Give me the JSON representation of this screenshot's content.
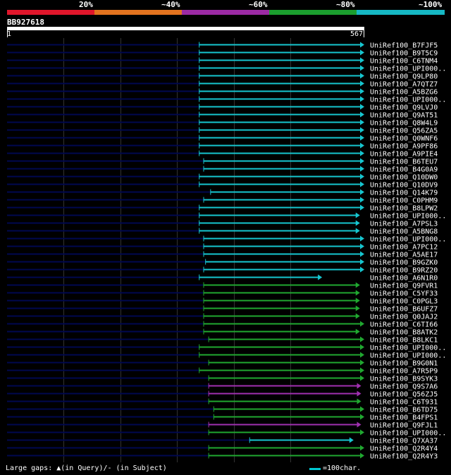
{
  "legend": {
    "labels": [
      "20%",
      "~40%",
      "~60%",
      "~80%",
      "~100%"
    ],
    "colors": [
      "#e0162b",
      "#e2731f",
      "#9b2aa3",
      "#1b9e2e",
      "#16b8c4"
    ]
  },
  "query": {
    "name": "BB927618",
    "start": "1",
    "end": "567",
    "length": 567
  },
  "hits": [
    {
      "name": "UniRef100_B7FJF5",
      "start": 305,
      "end": 567,
      "color": "cyan"
    },
    {
      "name": "UniRef100_B9T5C9",
      "start": 305,
      "end": 567,
      "color": "cyan"
    },
    {
      "name": "UniRef100_C6TNM4",
      "start": 305,
      "end": 567,
      "color": "cyan"
    },
    {
      "name": "UniRef100_UPI000..",
      "start": 305,
      "end": 567,
      "color": "cyan"
    },
    {
      "name": "UniRef100_Q9LP80",
      "start": 305,
      "end": 567,
      "color": "cyan"
    },
    {
      "name": "UniRef100_A7QTZ7",
      "start": 305,
      "end": 567,
      "color": "cyan"
    },
    {
      "name": "UniRef100_A5BZG6",
      "start": 305,
      "end": 567,
      "color": "cyan"
    },
    {
      "name": "UniRef100_UPI000..",
      "start": 305,
      "end": 567,
      "color": "cyan"
    },
    {
      "name": "UniRef100_Q9LVJ0",
      "start": 305,
      "end": 567,
      "color": "cyan"
    },
    {
      "name": "UniRef100_Q9AT51",
      "start": 305,
      "end": 567,
      "color": "cyan"
    },
    {
      "name": "UniRef100_Q8W4L9",
      "start": 305,
      "end": 567,
      "color": "cyan"
    },
    {
      "name": "UniRef100_Q56ZA5",
      "start": 305,
      "end": 567,
      "color": "cyan"
    },
    {
      "name": "UniRef100_Q0WNF6",
      "start": 305,
      "end": 567,
      "color": "cyan"
    },
    {
      "name": "UniRef100_A9PF86",
      "start": 305,
      "end": 567,
      "color": "cyan"
    },
    {
      "name": "UniRef100_A9PIE4",
      "start": 305,
      "end": 567,
      "color": "cyan"
    },
    {
      "name": "UniRef100_B6TEU7",
      "start": 312,
      "end": 567,
      "color": "cyan"
    },
    {
      "name": "UniRef100_B4G0A9",
      "start": 312,
      "end": 567,
      "color": "cyan"
    },
    {
      "name": "UniRef100_Q10DW0",
      "start": 305,
      "end": 567,
      "color": "cyan"
    },
    {
      "name": "UniRef100_Q10DV9",
      "start": 305,
      "end": 567,
      "color": "cyan"
    },
    {
      "name": "UniRef100_Q14K79",
      "start": 323,
      "end": 567,
      "color": "cyan"
    },
    {
      "name": "UniRef100_C0PHM9",
      "start": 312,
      "end": 567,
      "color": "cyan"
    },
    {
      "name": "UniRef100_B8LPW2",
      "start": 305,
      "end": 567,
      "color": "cyan"
    },
    {
      "name": "UniRef100_UPI000..",
      "start": 305,
      "end": 560,
      "color": "cyan"
    },
    {
      "name": "UniRef100_A7PSL3",
      "start": 305,
      "end": 560,
      "color": "cyan"
    },
    {
      "name": "UniRef100_A5BNG8",
      "start": 305,
      "end": 560,
      "color": "cyan"
    },
    {
      "name": "UniRef100_UPI000..",
      "start": 312,
      "end": 567,
      "color": "cyan"
    },
    {
      "name": "UniRef100_A7PC12",
      "start": 312,
      "end": 567,
      "color": "cyan"
    },
    {
      "name": "UniRef100_A5AE17",
      "start": 312,
      "end": 567,
      "color": "cyan"
    },
    {
      "name": "UniRef100_B9GZK0",
      "start": 315,
      "end": 567,
      "color": "cyan"
    },
    {
      "name": "UniRef100_B9RZ20",
      "start": 312,
      "end": 567,
      "color": "cyan"
    },
    {
      "name": "UniRef100_A6N1R0",
      "start": 305,
      "end": 500,
      "color": "cyan"
    },
    {
      "name": "UniRef100_Q9FVR1",
      "start": 312,
      "end": 560,
      "color": "green"
    },
    {
      "name": "UniRef100_C5YF33",
      "start": 312,
      "end": 560,
      "color": "green"
    },
    {
      "name": "UniRef100_C0PGL3",
      "start": 312,
      "end": 560,
      "color": "green"
    },
    {
      "name": "UniRef100_B6UFZ7",
      "start": 312,
      "end": 560,
      "color": "green"
    },
    {
      "name": "UniRef100_Q0JAJ2",
      "start": 312,
      "end": 560,
      "color": "green"
    },
    {
      "name": "UniRef100_C6TI66",
      "start": 312,
      "end": 567,
      "color": "green"
    },
    {
      "name": "UniRef100_B8ATK2",
      "start": 312,
      "end": 560,
      "color": "green"
    },
    {
      "name": "UniRef100_B8LKC1",
      "start": 320,
      "end": 567,
      "color": "green"
    },
    {
      "name": "UniRef100_UPI000..",
      "start": 305,
      "end": 567,
      "color": "green"
    },
    {
      "name": "UniRef100_UPI000..",
      "start": 305,
      "end": 567,
      "color": "green"
    },
    {
      "name": "UniRef100_B9G0N1",
      "start": 320,
      "end": 567,
      "color": "green"
    },
    {
      "name": "UniRef100_A7R5P9",
      "start": 305,
      "end": 567,
      "color": "green"
    },
    {
      "name": "UniRef100_B9SYK3",
      "start": 320,
      "end": 567,
      "color": "green"
    },
    {
      "name": "UniRef100_Q9S7A6",
      "start": 320,
      "end": 562,
      "color": "purple"
    },
    {
      "name": "UniRef100_Q56ZJ5",
      "start": 320,
      "end": 562,
      "color": "purple"
    },
    {
      "name": "UniRef100_C6T931",
      "start": 320,
      "end": 562,
      "color": "green"
    },
    {
      "name": "UniRef100_B6TD75",
      "start": 328,
      "end": 567,
      "color": "green"
    },
    {
      "name": "UniRef100_B4FPS1",
      "start": 328,
      "end": 567,
      "color": "green"
    },
    {
      "name": "UniRef100_Q9FJL1",
      "start": 320,
      "end": 562,
      "color": "purple"
    },
    {
      "name": "UniRef100_UPI000..",
      "start": 320,
      "end": 567,
      "color": "green"
    },
    {
      "name": "UniRef100_Q7XA37",
      "start": 385,
      "end": 550,
      "color": "cyan"
    },
    {
      "name": "UniRef100_Q2R4Y4",
      "start": 320,
      "end": 567,
      "color": "green"
    },
    {
      "name": "UniRef100_Q2R4Y3",
      "start": 320,
      "end": 567,
      "color": "green"
    }
  ],
  "colors": {
    "cyan": "#16c6d0",
    "green": "#20a830",
    "purple": "#a030b0",
    "navy": "#000850",
    "grid": "#333333"
  },
  "footer": {
    "text": "Large gaps: ▲(in Query)/- (in Subject)",
    "scale": "=100char."
  }
}
